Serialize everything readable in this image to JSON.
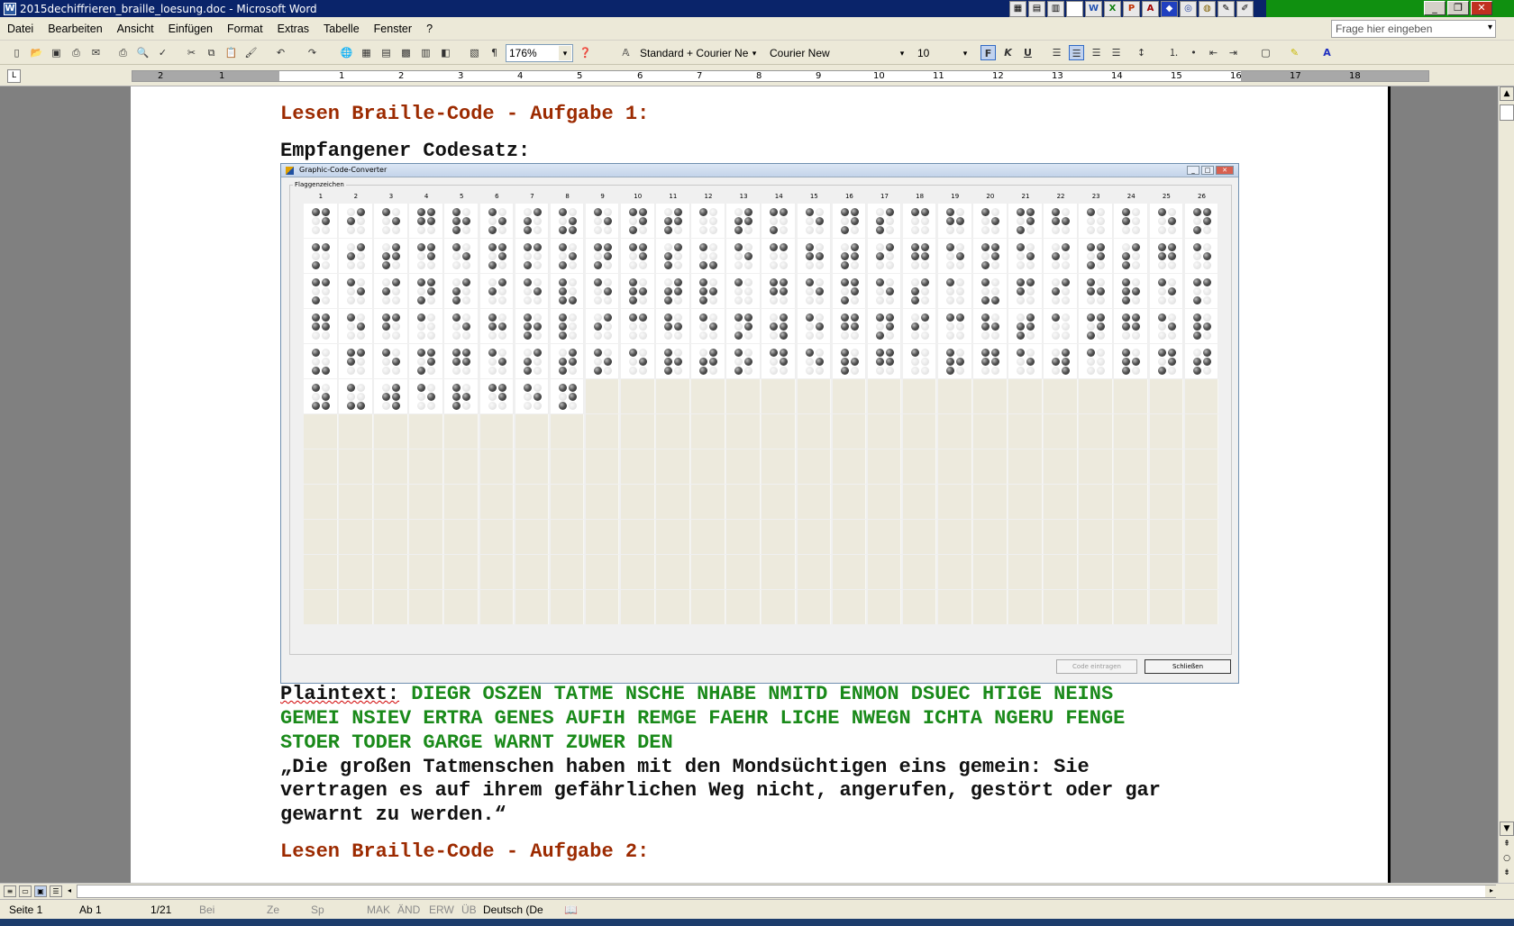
{
  "window": {
    "title": "2015dechiffrieren_braille_loesung.doc - Microsoft Word"
  },
  "menu": [
    "Datei",
    "Bearbeiten",
    "Ansicht",
    "Einfügen",
    "Format",
    "Extras",
    "Tabelle",
    "Fenster",
    "?"
  ],
  "help_box": {
    "placeholder": "Frage hier eingeben"
  },
  "toolbar": {
    "zoom": "176%",
    "style": "Standard + Courier Ne",
    "font": "Courier New",
    "size": "10",
    "bold_label": "F",
    "italic_label": "K",
    "underline_label": "U"
  },
  "ruler_numbers": [
    "2",
    "1",
    "1",
    "2",
    "3",
    "4",
    "5",
    "6",
    "7",
    "8",
    "9",
    "10",
    "11",
    "12",
    "13",
    "14",
    "15",
    "16",
    "17",
    "18"
  ],
  "document": {
    "heading1": "Lesen Braille-Code - Aufgabe 1:",
    "heading1_word": "Braille-Code",
    "subheading": "Empfangener Codesatz:",
    "plaintext_label": "Plaintext:",
    "plaintext_line1": "DIEGR OSZEN TATME NSCHE NHABE NMITD ENMON DSUEC HTIGE NEINS",
    "plaintext_line2": "GEMEI NSIEV ERTRA GENES AUFIH REMGE FAEHR LICHE NWEGN ICHTA NGERU FENGE",
    "plaintext_line3": "STOER TODER GARGE WARNT ZUWER DEN",
    "quote_line1": "„Die großen Tatmenschen haben mit den Mondsüchtigen eins gemein: Sie",
    "quote_line2": "vertragen es auf ihrem gefährlichen Weg nicht, angerufen, gestört oder gar",
    "quote_line3": "gewarnt zu werden.“",
    "heading2": "Lesen Braille-Code - Aufgabe 2:"
  },
  "embedded_app": {
    "title": "Graphic-Code-Converter",
    "group_label": "Flaggenzeichen",
    "column_numbers": [
      "1",
      "2",
      "3",
      "4",
      "5",
      "6",
      "7",
      "8",
      "9",
      "10",
      "11",
      "12",
      "13",
      "14",
      "15",
      "16",
      "17",
      "18",
      "19",
      "20",
      "21",
      "22",
      "23",
      "24",
      "25",
      "26"
    ],
    "insert_button": "Code eintragen",
    "close_button": "Schließen",
    "braille_rows": [
      [
        "DIEGR",
        "OSZEN",
        "TATME",
        "NSCHE",
        "NHABE",
        "N"
      ],
      [
        "MITD",
        "ENMON",
        "DSUEC",
        "HTIGE",
        "NEINS"
      ],
      [
        "GEMEI",
        "NSIEV",
        "ERTRA",
        "GENES",
        "AUFIH",
        "R"
      ],
      [
        "EMGE",
        "FAEHR",
        "LICHE",
        "NWEGN",
        "ICHTA",
        "N"
      ],
      [
        "GERU",
        "FENGE",
        "STOER",
        "TODER",
        "GARGE",
        "W"
      ],
      [
        "ARNT",
        "ZUW"
      ]
    ],
    "braille_cells": [
      "DIEGROSZENTATMENSCHENHABEN",
      "MITDENMONDSUECHTIGENEINSGE",
      "MEINSIEVERTRAGENESAUFIHREM",
      "GEFAEHRLICHENWEGNICHTANGER",
      "UFENGESTOERTODERGARGEWARNT",
      "ZUWERDEN"
    ]
  },
  "status": {
    "page": "Seite 1",
    "section": "Ab 1",
    "pages": "1/21",
    "at": "Bei",
    "line": "Ze",
    "col": "Sp",
    "rec": "MAK",
    "trk": "ÄND",
    "ext": "ERW",
    "ovr": "ÜB",
    "language": "Deutsch (De"
  }
}
